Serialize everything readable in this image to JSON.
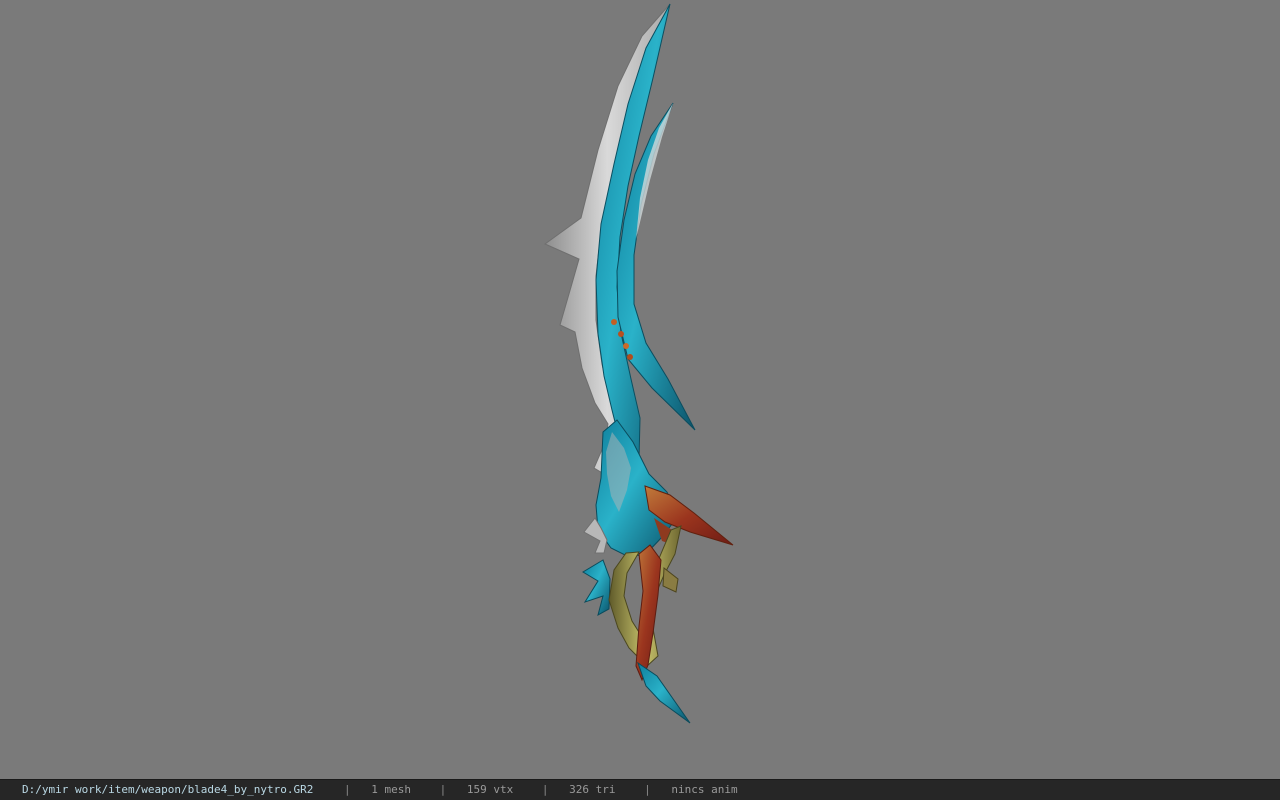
{
  "viewport": {
    "background": "#7a7a7a",
    "model_label": "blade-model-icon"
  },
  "status_bar": {
    "path": "D:/ymir work/item/weapon/blade4_by_nytro.GR2",
    "separator": "|",
    "mesh": "1 mesh",
    "vertices": "159 vtx",
    "triangles": "326 tri",
    "animation": "nincs anim"
  }
}
